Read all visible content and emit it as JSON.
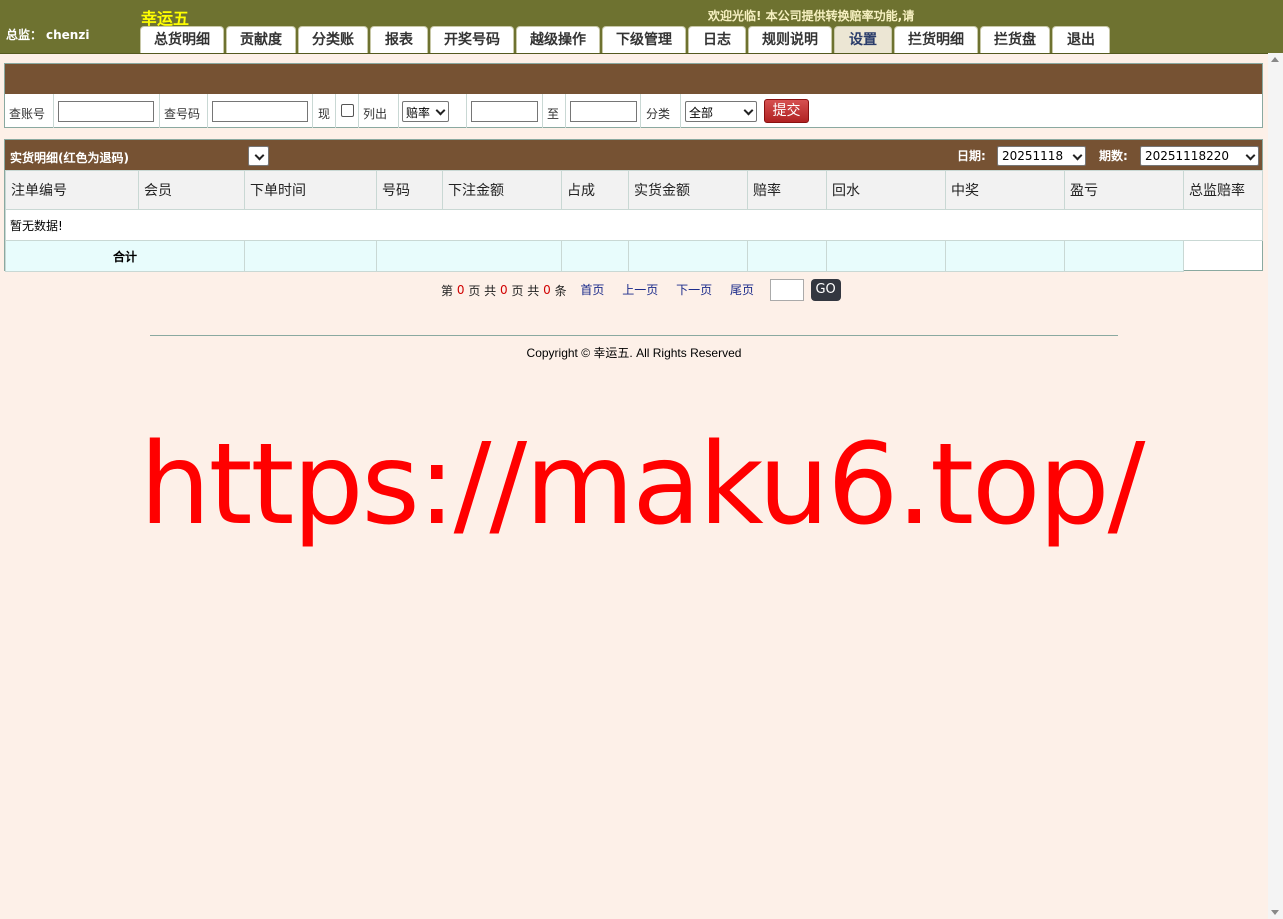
{
  "header": {
    "user_prefix": "总监：",
    "username": "chenzi",
    "app_title": "幸运五",
    "welcome": "欢迎光临! 本公司提供转换赔率功能,请",
    "tabs": [
      {
        "label": "总货明细"
      },
      {
        "label": "贡献度"
      },
      {
        "label": "分类账"
      },
      {
        "label": "报表"
      },
      {
        "label": "开奖号码"
      },
      {
        "label": "越级操作"
      },
      {
        "label": "下级管理"
      },
      {
        "label": "日志"
      },
      {
        "label": "规则说明"
      },
      {
        "label": "设置",
        "active": true
      },
      {
        "label": "拦货明细"
      },
      {
        "label": "拦货盘"
      },
      {
        "label": "退出"
      }
    ]
  },
  "filter": {
    "account_label": "查账号",
    "account_value": "",
    "number_label": "查号码",
    "number_value": "",
    "current_label": "现",
    "current_checked": false,
    "list_label": "列出",
    "odds_select": "赔率",
    "range_from": "",
    "to_label": "至",
    "range_to": "",
    "category_label": "分类",
    "category_select": "全部",
    "submit_label": "提交"
  },
  "data_section": {
    "title": "实货明细(红色为退码)",
    "title_select": "",
    "date_label": "日期:",
    "date_value": "20251118",
    "period_label": "期数:",
    "period_value": "20251118220",
    "columns": [
      "注单编号",
      "会员",
      "下单时间",
      "号码",
      "下注金额",
      "占成",
      "实货金额",
      "赔率",
      "回水",
      "中奖",
      "盈亏",
      "总监赔率"
    ],
    "empty_text": "暂无数据!",
    "total_label": "合计"
  },
  "pager": {
    "prefix": "第",
    "current_page": "0",
    "page_word": "页 共",
    "total_pages": "0",
    "page_word2": "页 共",
    "total_records": "0",
    "record_word": "条",
    "first": "首页",
    "prev": "上一页",
    "next": "下一页",
    "last": "尾页",
    "go": "GO"
  },
  "footer": {
    "copyright": "Copyright © 幸运五. All Rights Reserved"
  },
  "watermark": "https://maku6.top/",
  "colors": {
    "header_bg": "#6e7230",
    "section_bar": "#765233",
    "page_bg": "#fdf0e8",
    "title_yellow": "#ffff00",
    "watermark_red": "#ff0000"
  }
}
